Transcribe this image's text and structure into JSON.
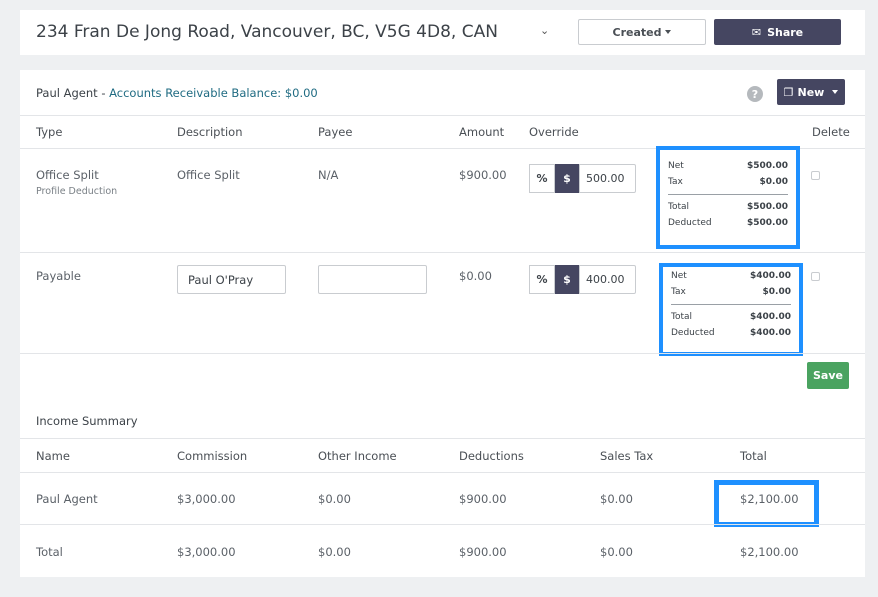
{
  "header": {
    "address": "234 Fran De Jong Road, Vancouver, BC, V5G 4D8, CAN",
    "created_label": "Created",
    "share_label": "Share"
  },
  "panel": {
    "agent_name": "Paul Agent",
    "separator": "-",
    "ar_label": "Accounts Receivable Balance: $0.00",
    "help_icon": "?",
    "new_label": "New",
    "columns": {
      "type": "Type",
      "description": "Description",
      "payee": "Payee",
      "amount": "Amount",
      "override": "Override",
      "delete": "Delete"
    },
    "rows": [
      {
        "type": "Office Split",
        "subtype": "Profile Deduction",
        "description": "Office Split",
        "payee": "N/A",
        "amount": "$900.00",
        "pct_label": "%",
        "dollar_label": "$",
        "override_value": "500.00",
        "summary": {
          "net_label": "Net",
          "net": "$500.00",
          "tax_label": "Tax",
          "tax": "$0.00",
          "total_label": "Total",
          "total": "$500.00",
          "deducted_label": "Deducted",
          "deducted": "$500.00"
        }
      },
      {
        "type": "Payable",
        "description_value": "Paul O'Pray",
        "payee_value": "",
        "amount": "$0.00",
        "pct_label": "%",
        "dollar_label": "$",
        "override_value": "400.00",
        "summary": {
          "net_label": "Net",
          "net": "$400.00",
          "tax_label": "Tax",
          "tax": "$0.00",
          "total_label": "Total",
          "total": "$400.00",
          "deducted_label": "Deducted",
          "deducted": "$400.00"
        }
      }
    ],
    "save_label": "Save"
  },
  "income_summary": {
    "title": "Income Summary",
    "columns": {
      "name": "Name",
      "commission": "Commission",
      "other_income": "Other Income",
      "deductions": "Deductions",
      "sales_tax": "Sales Tax",
      "total": "Total"
    },
    "rows": [
      {
        "name": "Paul Agent",
        "commission": "$3,000.00",
        "other_income": "$0.00",
        "deductions": "$900.00",
        "sales_tax": "$0.00",
        "total": "$2,100.00"
      },
      {
        "name": "Total",
        "commission": "$3,000.00",
        "other_income": "$0.00",
        "deductions": "$900.00",
        "sales_tax": "$0.00",
        "total": "$2,100.00"
      }
    ]
  },
  "colors": {
    "primary_button": "#454661",
    "save_button": "#4aa360",
    "highlight_border": "#1e90ff",
    "link": "#1f6b82"
  }
}
